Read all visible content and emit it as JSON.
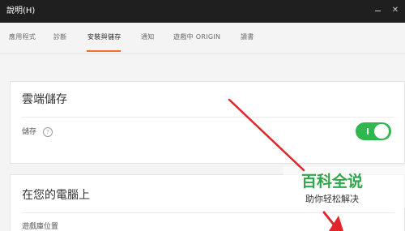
{
  "titlebar": {
    "menu_label": "說明(H)",
    "minimize_glyph": "—",
    "close_glyph": "✕"
  },
  "tabs": [
    {
      "label": "應用程式",
      "active": false
    },
    {
      "label": "診斷",
      "active": false
    },
    {
      "label": "安裝與儲存",
      "active": true
    },
    {
      "label": "通知",
      "active": false
    },
    {
      "label": "遊戲中 ORIGIN",
      "active": false
    },
    {
      "label": "讀書",
      "active": false
    }
  ],
  "cloud_section": {
    "title": "雲端儲存",
    "storage_label": "儲存",
    "help_glyph": "?",
    "toggle_on": true
  },
  "local_section": {
    "title": "在您的電腦上",
    "library_label": "遊戲庫位置"
  },
  "watermark": {
    "brand": "百科全说",
    "slogan": "助你轻松解决"
  },
  "colors": {
    "accent": "#f56c2d",
    "toggle": "#2fb84f",
    "arrow": "#e0262a",
    "watermark_brand": "#2ea84a"
  }
}
